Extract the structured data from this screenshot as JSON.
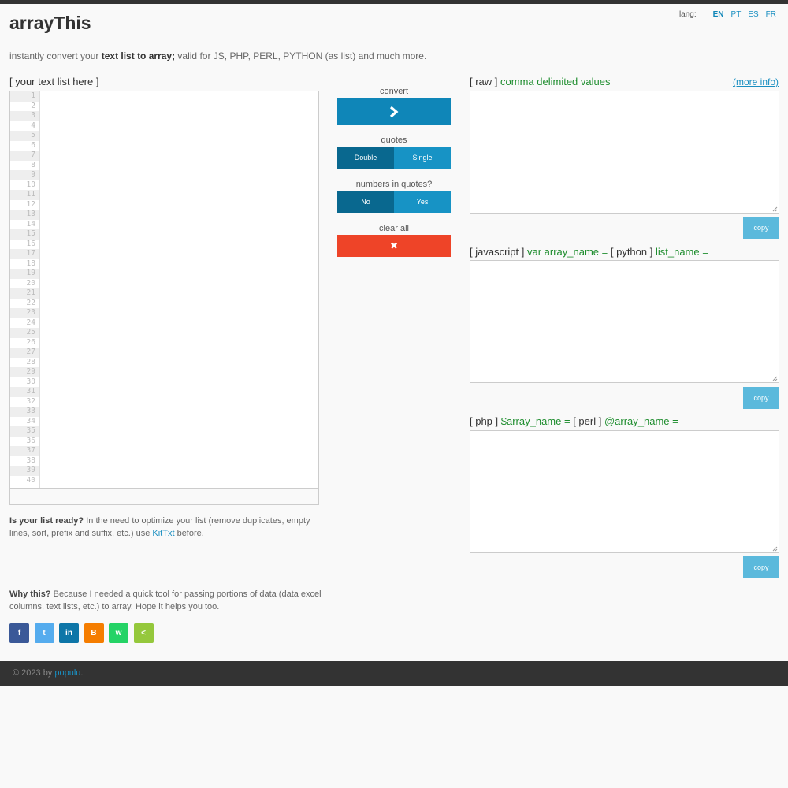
{
  "app": {
    "title": "arrayThis",
    "tagline_pre": "instantly convert your ",
    "tagline_bold": "text list to array;",
    "tagline_post": " valid for JS, PHP, PERL, PYTHON (as list) and much more."
  },
  "lang": {
    "label": "lang:",
    "options": [
      "EN",
      "PT",
      "ES",
      "FR"
    ],
    "active": "EN"
  },
  "input": {
    "label": "[ your text list here ]",
    "line_numbers": [
      "1",
      "2",
      "3",
      "4",
      "5",
      "6",
      "7",
      "8",
      "9",
      "10",
      "11",
      "12",
      "13",
      "14",
      "15",
      "16",
      "17",
      "18",
      "19",
      "20",
      "21",
      "22",
      "23",
      "24",
      "25",
      "26",
      "27",
      "28",
      "29",
      "30",
      "31",
      "32",
      "33",
      "34",
      "35",
      "36",
      "37",
      "38",
      "39",
      "40"
    ]
  },
  "controls": {
    "convert_label": "convert",
    "quotes_label": "quotes",
    "quotes_double": "Double",
    "quotes_single": "Single",
    "numbers_label": "numbers in quotes?",
    "numbers_no": "No",
    "numbers_yes": "Yes",
    "clear_label": "clear all"
  },
  "outputs": {
    "raw": {
      "tag": "[ raw ]",
      "desc": "comma delimited values",
      "more_info": "(more info)"
    },
    "js": {
      "tag": "[ javascript ]",
      "desc": "var array_name =",
      "tag2": "[ python ]",
      "desc2": "list_name ="
    },
    "php": {
      "tag": "[ php ]",
      "desc": "$array_name =",
      "tag2": "[ perl ]",
      "desc2": "@array_name ="
    },
    "copy_label": "copy"
  },
  "info": {
    "ready_bold": "Is your list ready?",
    "ready_text": " In the need to optimize your list (remove duplicates, empty lines, sort, prefix and suffix, etc.) use ",
    "ready_link": "KitTxt",
    "ready_after": " before.",
    "why_bold": "Why this?",
    "why_text": " Because I needed a quick tool for passing portions of data (data excel columns, text lists, etc.) to array. Hope it helps you too."
  },
  "social": [
    {
      "name": "facebook",
      "glyph": "f",
      "color": "#3b5998"
    },
    {
      "name": "twitter",
      "glyph": "t",
      "color": "#55acee"
    },
    {
      "name": "linkedin",
      "glyph": "in",
      "color": "#0e76a8"
    },
    {
      "name": "blogger",
      "glyph": "B",
      "color": "#f57d00"
    },
    {
      "name": "whatsapp",
      "glyph": "w",
      "color": "#25d366"
    },
    {
      "name": "share",
      "glyph": "<",
      "color": "#95c83c"
    }
  ],
  "footer": {
    "copyright": "© 2023 by ",
    "author": "populu",
    "end": "."
  }
}
